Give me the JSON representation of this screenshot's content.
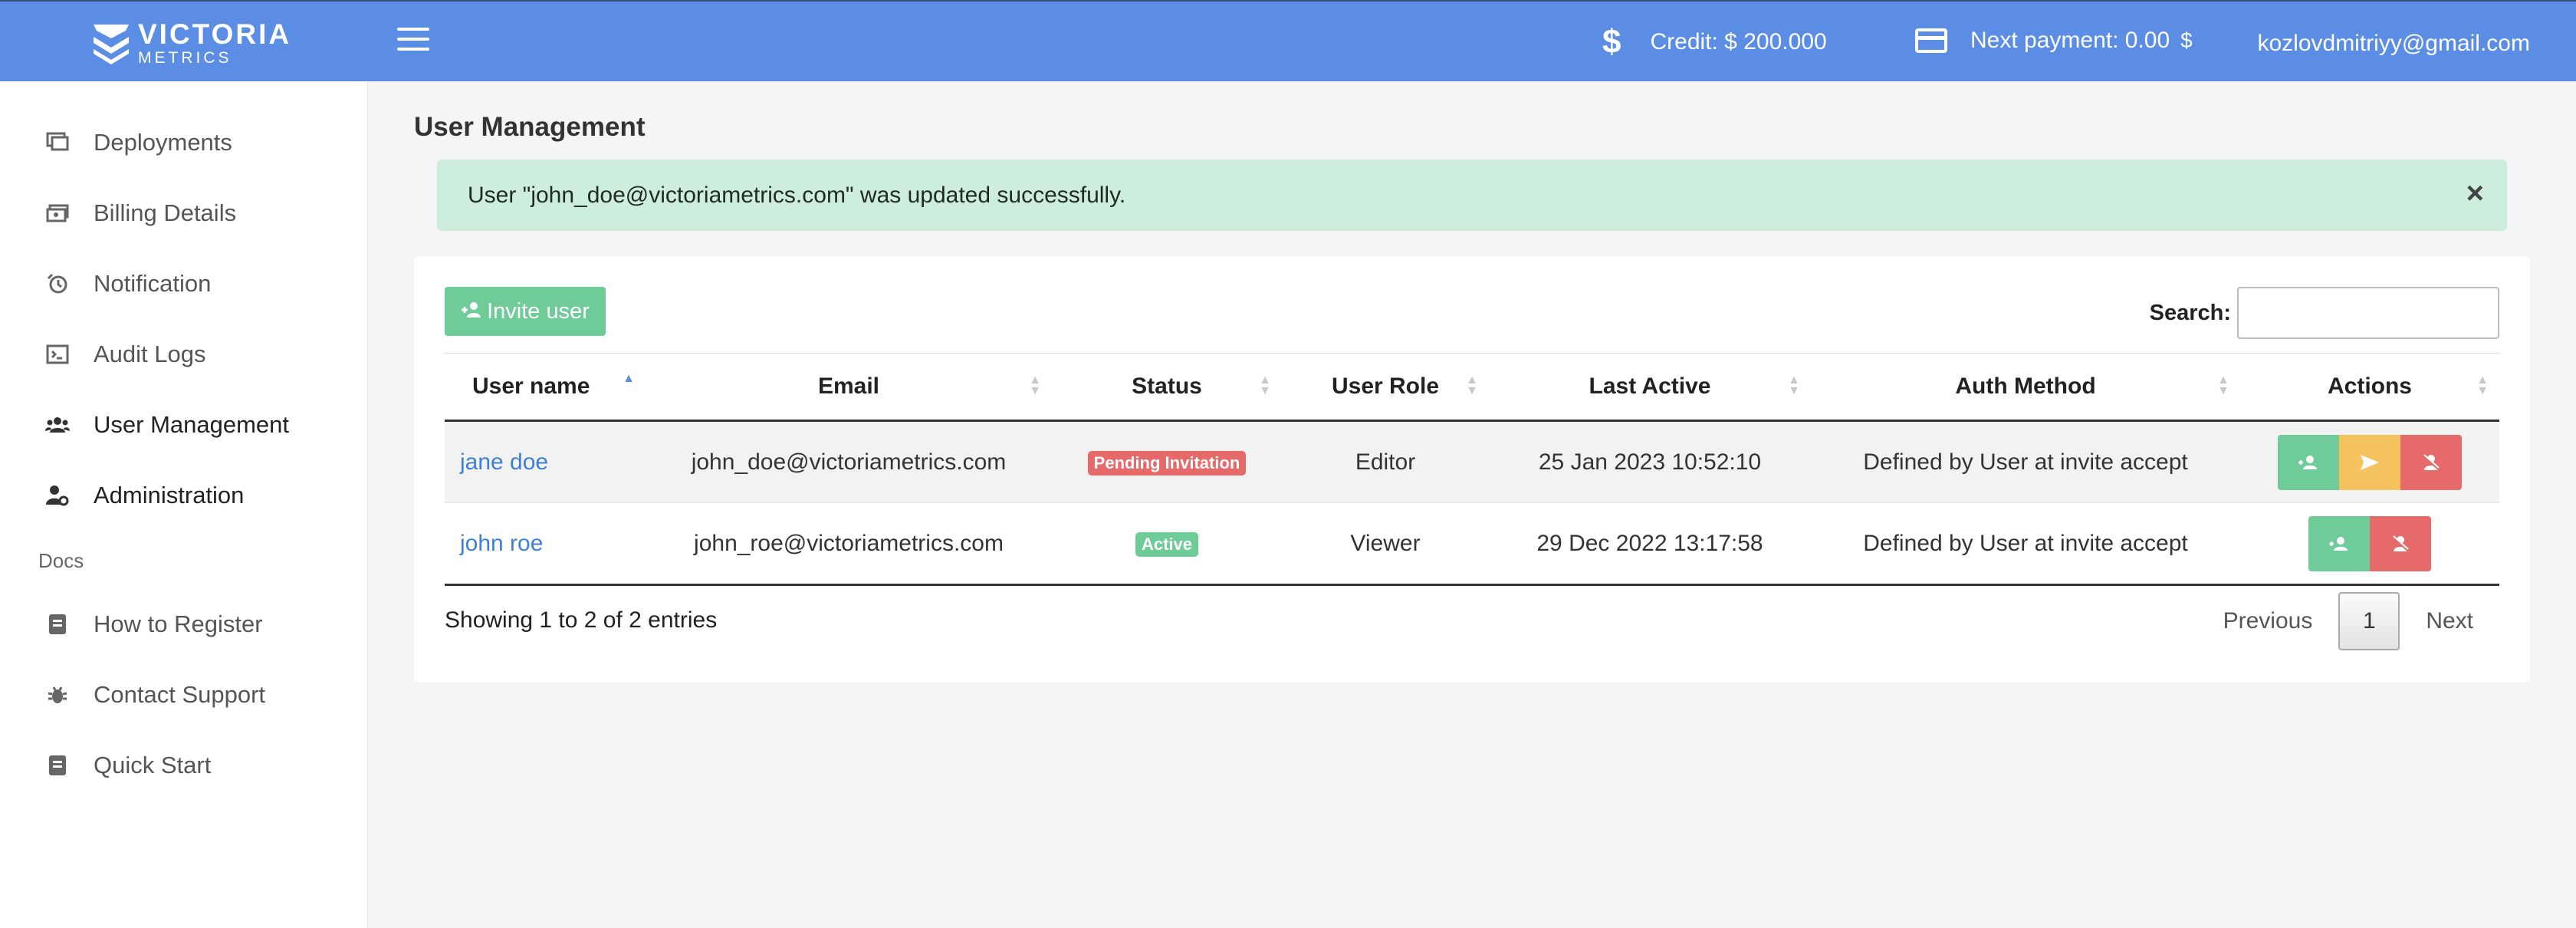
{
  "header": {
    "logo_line1": "VICTORIA",
    "logo_line2": "METRICS",
    "credit_label": "Credit: $ 200.000",
    "next_payment_label": "Next payment: 0.00",
    "next_payment_currency": "$",
    "user_email": "kozlovdmitriyy@gmail.com",
    "accent_color": "#5a8de3"
  },
  "sidebar": {
    "items": [
      {
        "label": "Deployments",
        "icon": "monitor-icon"
      },
      {
        "label": "Billing Details",
        "icon": "money-icon"
      },
      {
        "label": "Notification",
        "icon": "alarm-icon"
      },
      {
        "label": "Audit Logs",
        "icon": "terminal-icon"
      },
      {
        "label": "User Management",
        "icon": "users-icon"
      },
      {
        "label": "Administration",
        "icon": "user-gear-icon"
      }
    ],
    "docs_label": "Docs",
    "docs_items": [
      {
        "label": "How to Register",
        "icon": "document-icon"
      },
      {
        "label": "Contact Support",
        "icon": "bug-icon"
      },
      {
        "label": "Quick Start",
        "icon": "document-icon"
      }
    ]
  },
  "main": {
    "title": "User Management",
    "alert_text": "User \"john_doe@victoriametrics.com\" was updated successfully.",
    "alert_close": "×",
    "invite_label": "Invite user",
    "search_label": "Search:",
    "search_value": "",
    "columns": [
      "User name",
      "Email",
      "Status",
      "User Role",
      "Last Active",
      "Auth Method",
      "Actions"
    ],
    "rows": [
      {
        "name": "jane doe",
        "email": "john_doe@victoriametrics.com",
        "status": "Pending Invitation",
        "role": "Editor",
        "last_active": "25 Jan 2023 10:52:10",
        "auth": "Defined by User at invite accept"
      },
      {
        "name": "john roe",
        "email": "john_roe@victoriametrics.com",
        "status": "Active",
        "role": "Viewer",
        "last_active": "29 Dec 2022 13:17:58",
        "auth": "Defined by User at invite accept"
      }
    ],
    "showing": "Showing 1 to 2 of 2 entries",
    "pager": {
      "previous": "Previous",
      "current": "1",
      "next": "Next"
    }
  }
}
